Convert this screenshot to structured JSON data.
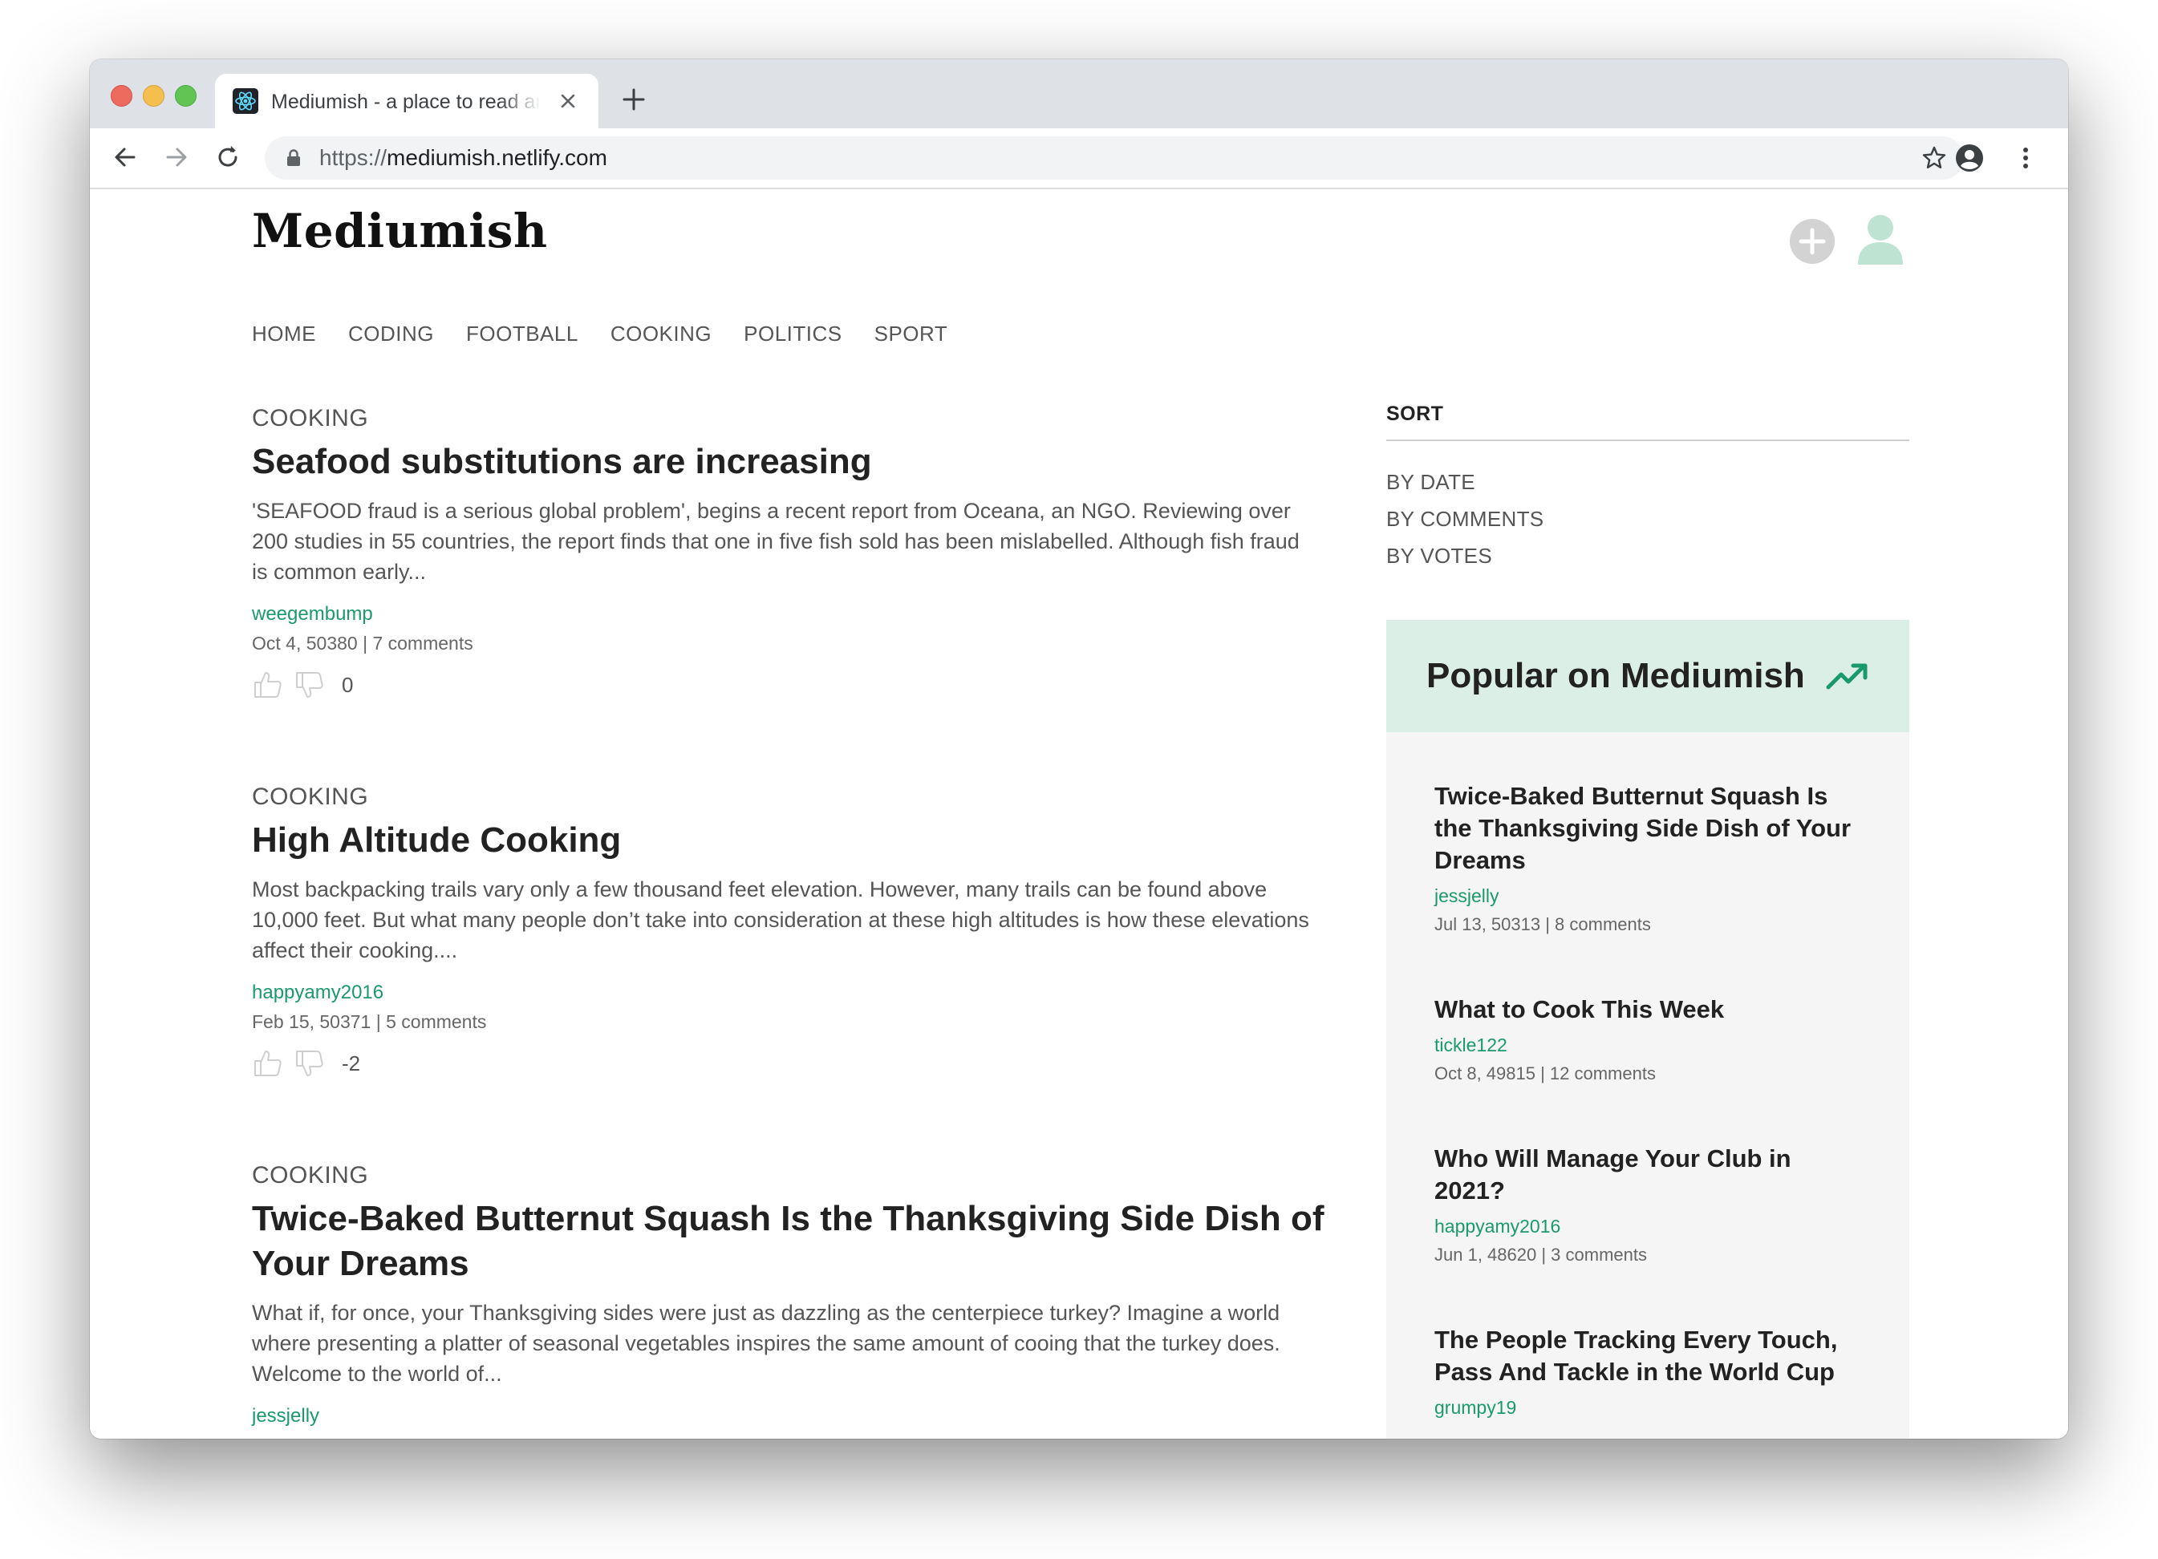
{
  "browser": {
    "tab_title": "Mediumish - a place to read and write",
    "url_scheme": "https://",
    "url_host": "mediumish.netlify.com"
  },
  "site": {
    "title": "Mediumish",
    "nav": [
      "HOME",
      "CODING",
      "FOOTBALL",
      "COOKING",
      "POLITICS",
      "SPORT"
    ]
  },
  "articles": [
    {
      "category": "COOKING",
      "title": "Seafood substitutions are increasing",
      "excerpt": "'SEAFOOD fraud is a serious global problem', begins a recent report from Oceana, an NGO. Reviewing over 200 studies in 55 countries, the report finds that one in five fish sold has been mislabelled. Although fish fraud is common early...",
      "author": "weegembump",
      "meta": "Oct 4, 50380 | 7 comments",
      "score": "0"
    },
    {
      "category": "COOKING",
      "title": "High Altitude Cooking",
      "excerpt": "Most backpacking trails vary only a few thousand feet elevation. However, many trails can be found above 10,000 feet. But what many people don’t take into consideration at these high altitudes is how these elevations affect their cooking....",
      "author": "happyamy2016",
      "meta": "Feb 15, 50371 | 5 comments",
      "score": "-2"
    },
    {
      "category": "COOKING",
      "title": "Twice-Baked Butternut Squash Is the Thanksgiving Side Dish of Your Dreams",
      "excerpt": "What if, for once, your Thanksgiving sides were just as dazzling as the centerpiece turkey? Imagine a world where presenting a platter of seasonal vegetables inspires the same amount of cooing that the turkey does. Welcome to the world of...",
      "author": "jessjelly"
    }
  ],
  "sidebar": {
    "sort_title": "SORT",
    "sort_options": [
      "BY DATE",
      "BY COMMENTS",
      "BY VOTES"
    ],
    "popular_title": "Popular on Mediumish",
    "popular": [
      {
        "title": "Twice-Baked Butternut Squash Is the Thanksgiving Side Dish of Your Dreams",
        "author": "jessjelly",
        "meta": "Jul 13, 50313 | 8 comments"
      },
      {
        "title": "What to Cook This Week",
        "author": "tickle122",
        "meta": "Oct 8, 49815 | 12 comments"
      },
      {
        "title": "Who Will Manage Your Club in 2021?",
        "author": "happyamy2016",
        "meta": "Jun 1, 48620 | 3 comments"
      },
      {
        "title": "The People Tracking Every Touch, Pass And Tackle in the World Cup",
        "author": "grumpy19"
      }
    ]
  },
  "colors": {
    "accent_green": "#1a9a6c",
    "popular_header_bg": "#dcefe6",
    "sidebar_bg": "#f5f5f5"
  }
}
